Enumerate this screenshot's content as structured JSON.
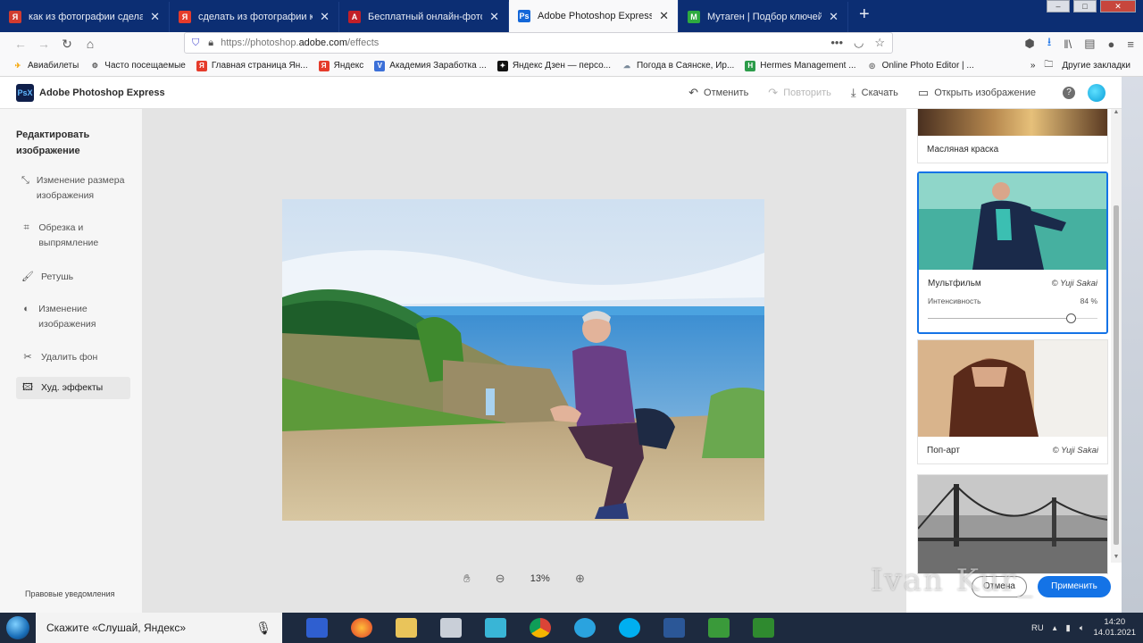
{
  "browser": {
    "tabs": [
      {
        "title": "как из фотографии сделать ка",
        "favicon_color": "#d13b2f",
        "favicon_glyph": "Я"
      },
      {
        "title": "сделать из фотографии карти",
        "favicon_color": "#e53b2b",
        "favicon_glyph": "Я"
      },
      {
        "title": "Бесплатный онлайн-фоторед",
        "favicon_color": "#c21f28",
        "favicon_glyph": "A"
      },
      {
        "title": "Adobe Photoshop Express",
        "favicon_color": "#1467d8",
        "favicon_glyph": "Ps",
        "active": true
      },
      {
        "title": "Мутаген | Подбор ключей",
        "favicon_color": "#2eaa3f",
        "favicon_glyph": "M"
      }
    ],
    "url_prefix": "https://photoshop.",
    "url_domain": "adobe.com",
    "url_path": "/effects",
    "bookmarks": [
      {
        "label": "Авиабилеты",
        "icon_color": "#f6a400",
        "glyph": "✈"
      },
      {
        "label": "Часто посещаемые",
        "icon_color": "#555555",
        "glyph": "⚙"
      },
      {
        "label": "Главная страница Ян...",
        "icon_color": "#e53b2b",
        "glyph": "Я"
      },
      {
        "label": "Яндекс",
        "icon_color": "#e53b2b",
        "glyph": "Я"
      },
      {
        "label": "Академия Заработка ...",
        "icon_color": "#3b6fd8",
        "glyph": "V"
      },
      {
        "label": "Яндекс Дзен — персо...",
        "icon_color": "#111111",
        "glyph": "✦"
      },
      {
        "label": "Погода в Саянске, Ир...",
        "icon_color": "#7a8a9a",
        "glyph": "☁"
      },
      {
        "label": "Hermes Management ...",
        "icon_color": "#2c9c4a",
        "glyph": "H"
      },
      {
        "label": "Online Photo Editor | ...",
        "icon_color": "#666666",
        "glyph": "◎"
      }
    ],
    "other_bookmarks": "Другие закладки"
  },
  "app": {
    "name": "Adobe Photoshop Express",
    "logo": "PsX",
    "undo": "Отменить",
    "redo": "Повторить",
    "download": "Скачать",
    "open_image": "Открыть изображение",
    "help": "?"
  },
  "sidebar": {
    "title": "Редактировать изображение",
    "items": [
      {
        "label": "Изменение размера изображения",
        "icon": "resize-icon"
      },
      {
        "label": "Обрезка и выпрямление",
        "icon": "crop-icon"
      },
      {
        "label": "Ретушь",
        "icon": "brush-icon"
      },
      {
        "label": "Изменение изображения",
        "icon": "adjust-icon"
      },
      {
        "label": "Удалить фон",
        "icon": "scissors-icon"
      },
      {
        "label": "Худ. эффекты",
        "icon": "effects-icon",
        "selected": true
      }
    ],
    "footer": "Правовые уведомления"
  },
  "canvas": {
    "zoom": "13%"
  },
  "effects": {
    "items": [
      {
        "name": "Масляная краска",
        "author": ""
      },
      {
        "name": "Мультфильм",
        "author": "© Yuji Sakai",
        "selected": true,
        "intensity_label": "Интенсивность",
        "intensity_text": "84 %",
        "intensity": 0.84
      },
      {
        "name": "Поп-арт",
        "author": "© Yuji Sakai"
      },
      {
        "name": "",
        "author": ""
      }
    ],
    "cancel": "Отмена",
    "apply": "Применить"
  },
  "watermark": "Ivan Kur_",
  "taskbar": {
    "search_placeholder": "Скажите «Слушай, Яндекс»",
    "lang": "RU",
    "time": "14:20",
    "date": "14.01.2021"
  },
  "colors": {
    "accent": "#1473e6",
    "tabstrip": "#0c2e73",
    "taskbar": "#1d2a3f"
  }
}
